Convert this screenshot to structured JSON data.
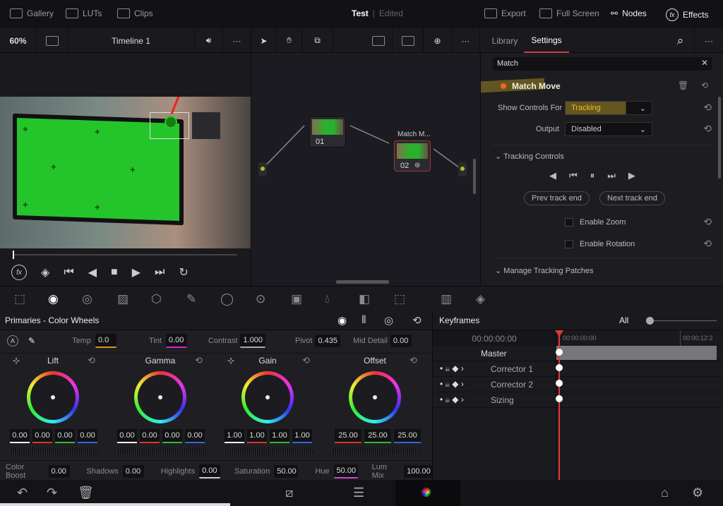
{
  "topbar": {
    "gallery": "Gallery",
    "luts": "LUTs",
    "clips": "Clips",
    "project": "Test",
    "status": "Edited",
    "export": "Export",
    "fullscreen": "Full Screen",
    "nodes": "Nodes",
    "effects": "Effects"
  },
  "toolbar": {
    "zoom": "60%",
    "timeline": "Timeline 1",
    "tabs": [
      {
        "label": "Library"
      },
      {
        "label": "Settings",
        "active": true
      }
    ]
  },
  "nodes": [
    {
      "label": "01"
    },
    {
      "label": "02",
      "title": "Match M..."
    }
  ],
  "settings": {
    "search_value": "Match",
    "effect": "Match Move",
    "show_controls_label": "Show Controls For",
    "show_controls_value": "Tracking",
    "output_label": "Output",
    "output_value": "Disabled",
    "tracking_section": "Tracking Controls",
    "prev_track": "Prev track end",
    "next_track": "Next track end",
    "enable_zoom": "Enable Zoom",
    "enable_rotation": "Enable Rotation",
    "patches_section": "Manage Tracking Patches",
    "accent": "#f26522",
    "highlight": "#e8c021"
  },
  "primaries": {
    "title": "Primaries - Color Wheels",
    "adjust": [
      {
        "label": "Temp",
        "value": "0.0"
      },
      {
        "label": "Tint",
        "value": "0.00"
      },
      {
        "label": "Contrast",
        "value": "1.000"
      },
      {
        "label": "Pivot",
        "value": "0.435"
      },
      {
        "label": "Mid Detail",
        "value": "0.00"
      }
    ],
    "wheels": [
      {
        "label": "Lift",
        "values": [
          "0.00",
          "0.00",
          "0.00",
          "0.00"
        ]
      },
      {
        "label": "Gamma",
        "values": [
          "0.00",
          "0.00",
          "0.00",
          "0.00"
        ]
      },
      {
        "label": "Gain",
        "values": [
          "1.00",
          "1.00",
          "1.00",
          "1.00"
        ]
      },
      {
        "label": "Offset",
        "values": [
          "25.00",
          "25.00",
          "25.00"
        ]
      }
    ],
    "bottom": [
      {
        "label": "Color Boost",
        "value": "0.00"
      },
      {
        "label": "Shadows",
        "value": "0.00"
      },
      {
        "label": "Highlights",
        "value": "0.00"
      },
      {
        "label": "Saturation",
        "value": "50.00"
      },
      {
        "label": "Hue",
        "value": "50.00"
      },
      {
        "label": "Lum Mix",
        "value": "100.00"
      }
    ]
  },
  "keyframes": {
    "title": "Keyframes",
    "filter": "All",
    "timecode": "00:00:00:00",
    "ruler_start": "00:00:00:00",
    "ruler_end": "00:00:12:2",
    "rows": [
      "Master",
      "Corrector 1",
      "Corrector 2",
      "Sizing"
    ],
    "playhead_color": "#e53935"
  }
}
